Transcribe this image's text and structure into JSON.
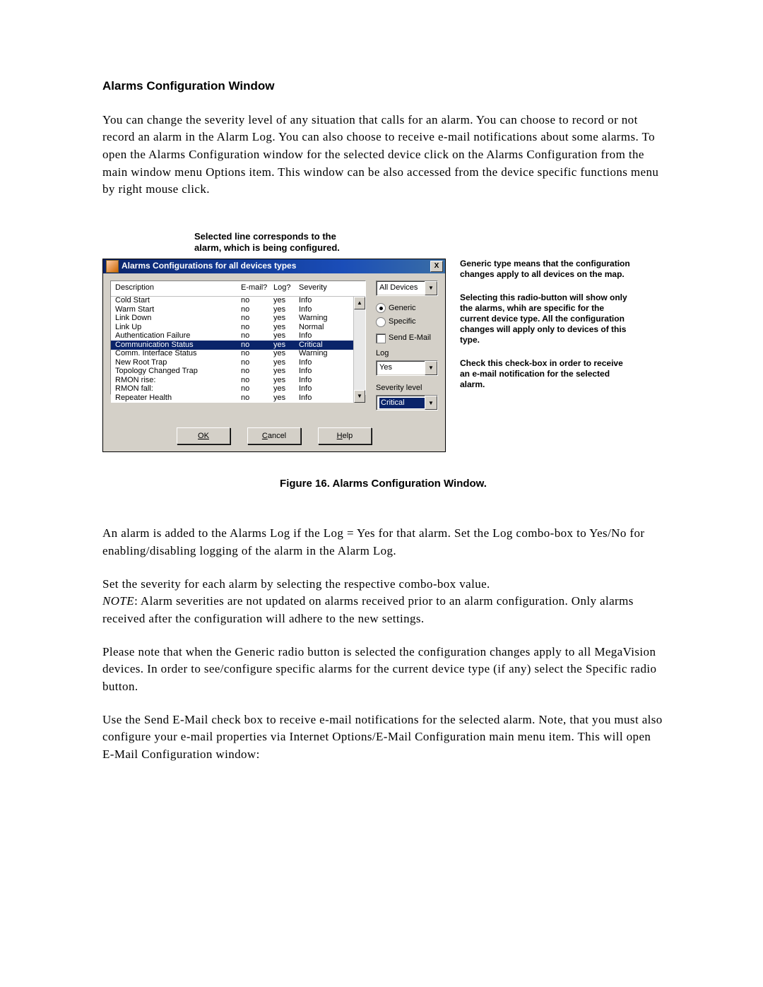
{
  "page_title": "Alarms Configuration Window",
  "intro_para": "You can change the severity level of any situation that calls for an alarm. You can choose to record or not record an alarm in the Alarm Log.  You can also choose to receive e-mail notifications about some alarms.  To open the Alarms Configuration window for the selected device click on the Alarms Configuration from the main window menu Options item. This window can be also accessed from the device specific functions menu by right mouse click.",
  "callout_top": "Selected line corresponds to the\nalarm, which is being configured.",
  "annot1": "Generic type means that the configuration changes apply to all devices on the map.",
  "annot2": "Selecting this radio-button will show only the alarms, whih are specific for the current device type. All the configuration changes will apply only to devices of this type.",
  "annot3": "Check this check-box in order to receive an e-mail notification for the selected alarm.",
  "caption": "Figure 16. Alarms Configuration Window.",
  "para2": "An alarm is added to the Alarms Log if the Log = Yes for that alarm. Set the Log combo-box to Yes/No for enabling/disabling logging of the alarm in the Alarm Log.",
  "para3a": "Set the severity for each alarm by selecting the respective combo-box value.",
  "para3b_prefix": "NOTE",
  "para3b_rest": ": Alarm severities are not updated on alarms received prior to an alarm configuration. Only alarms received after the configuration will adhere to the new settings.",
  "para4": "Please note that when the Generic radio button is selected the configuration changes apply to all MegaVision devices. In order to see/configure specific alarms for the current device type (if any) select the Specific radio button.",
  "para5": "Use the Send E-Mail check box to receive e-mail notifications for the selected alarm. Note, that you must also configure your e-mail properties via Internet Options/E-Mail Configuration main menu item. This will open E-Mail Configuration window:",
  "win": {
    "title": "Alarms Configurations for all devices types",
    "cols": {
      "desc": "Description",
      "email": "E-mail?",
      "log": "Log?",
      "sev": "Severity"
    },
    "rows": [
      {
        "desc": "Cold Start",
        "email": "no",
        "log": "yes",
        "sev": "Info",
        "selected": false
      },
      {
        "desc": "Warm Start",
        "email": "no",
        "log": "yes",
        "sev": "Info",
        "selected": false
      },
      {
        "desc": "Link Down",
        "email": "no",
        "log": "yes",
        "sev": "Warning",
        "selected": false
      },
      {
        "desc": "Link Up",
        "email": "no",
        "log": "yes",
        "sev": "Normal",
        "selected": false
      },
      {
        "desc": "Authentication Failure",
        "email": "no",
        "log": "yes",
        "sev": "Info",
        "selected": false
      },
      {
        "desc": "Communication Status",
        "email": "no",
        "log": "yes",
        "sev": "Critical",
        "selected": true
      },
      {
        "desc": "Comm. Interface Status",
        "email": "no",
        "log": "yes",
        "sev": "Warning",
        "selected": false
      },
      {
        "desc": "New Root Trap",
        "email": "no",
        "log": "yes",
        "sev": "Info",
        "selected": false
      },
      {
        "desc": "Topology Changed Trap",
        "email": "no",
        "log": "yes",
        "sev": "Info",
        "selected": false
      },
      {
        "desc": "RMON rise:",
        "email": "no",
        "log": "yes",
        "sev": "Info",
        "selected": false
      },
      {
        "desc": "RMON fall:",
        "email": "no",
        "log": "yes",
        "sev": "Info",
        "selected": false
      },
      {
        "desc": "Repeater Health",
        "email": "no",
        "log": "yes",
        "sev": "Info",
        "selected": false
      }
    ],
    "device_select": "All Devices",
    "radio_generic": "Generic",
    "radio_specific": "Specific",
    "check_sendemail": "Send E-Mail",
    "log_label": "Log",
    "log_select": "Yes",
    "sev_label": "Severity level",
    "sev_select": "Critical",
    "btn_ok": "OK",
    "btn_cancel": "Cancel",
    "btn_help": "Help",
    "close_x": "X"
  }
}
